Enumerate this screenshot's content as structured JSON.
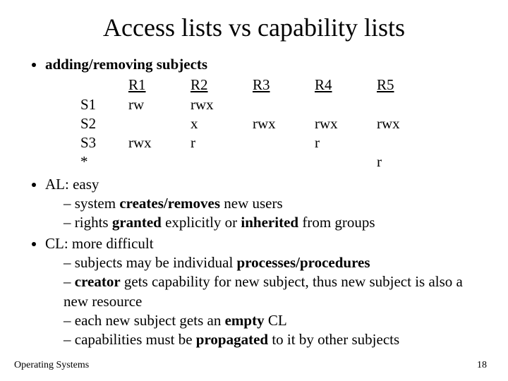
{
  "title": "Access lists vs capability lists",
  "bullets": {
    "b1": "adding/removing subjects",
    "b2": "AL: easy",
    "b2s1_pre": "system ",
    "b2s1_bold": "creates/removes",
    "b2s1_post": " new users",
    "b2s2_pre": "rights ",
    "b2s2_b1": "granted",
    "b2s2_mid": " explicitly or ",
    "b2s2_b2": "inherited",
    "b2s2_post": " from groups",
    "b3": "CL: more difficult",
    "b3s1_pre": "subjects may be individual ",
    "b3s1_bold": "processes/procedures",
    "b3s2_b1": "creator",
    "b3s2_post": " gets capability for new subject, thus new subject is also a new resource",
    "b3s3_pre": "each new subject gets an ",
    "b3s3_bold": "empty",
    "b3s3_post": " CL",
    "b3s4_pre": "capabilities must be ",
    "b3s4_bold": "propagated",
    "b3s4_post": " to it by other subjects"
  },
  "table": {
    "cols": [
      "R1",
      "R2",
      "R3",
      "R4",
      "R5"
    ],
    "rows": [
      {
        "h": "S1",
        "c": [
          "rw",
          "rwx",
          "",
          "",
          ""
        ]
      },
      {
        "h": "S2",
        "c": [
          "",
          "x",
          "rwx",
          "rwx",
          "rwx"
        ]
      },
      {
        "h": "S3",
        "c": [
          "rwx",
          "r",
          "",
          "r",
          ""
        ]
      },
      {
        "h": "*",
        "c": [
          "",
          "",
          "",
          "",
          "r"
        ]
      }
    ]
  },
  "footer": {
    "left": "Operating Systems",
    "right": "18"
  }
}
